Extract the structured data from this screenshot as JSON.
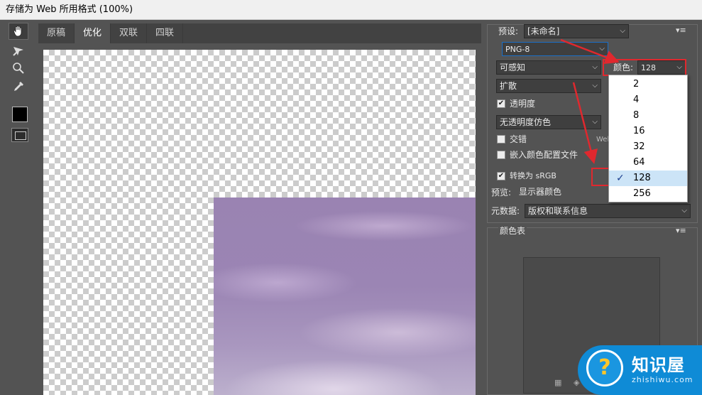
{
  "window": {
    "title": "存储为 Web 所用格式 (100%)"
  },
  "tabs": [
    {
      "label": "原稿",
      "active": false
    },
    {
      "label": "优化",
      "active": true
    },
    {
      "label": "双联",
      "active": false
    },
    {
      "label": "四联",
      "active": false
    }
  ],
  "tools": [
    "hand-icon",
    "slice-select-icon",
    "zoom-icon",
    "eyedropper-icon"
  ],
  "settings": {
    "preset_label": "预设:",
    "preset_value": "[未命名]",
    "format_value": "PNG-8",
    "reduction_value": "可感知",
    "colors_label": "颜色:",
    "colors_value": "128",
    "dither_value": "扩散",
    "transparency_label": "透明度",
    "transparency_dither_value": "无透明度仿色",
    "interlaced_label": "交错",
    "web_snap_label": "Web",
    "embed_profile_label": "嵌入颜色配置文件",
    "convert_srgb_label": "转换为 sRGB",
    "preview_label": "预览:",
    "preview_value": "显示器颜色",
    "metadata_label": "元数据:",
    "metadata_value": "版权和联系信息",
    "color_table_label": "颜色表"
  },
  "colors_dropdown": {
    "options": [
      "2",
      "4",
      "8",
      "16",
      "32",
      "64",
      "128",
      "256"
    ],
    "selected": "128"
  },
  "watermark": {
    "name": "知识屋",
    "url": "zhishiwu.com",
    "symbol": "?"
  },
  "accent_colors": {
    "highlight": "#e0282e",
    "selection": "#cce4f7",
    "panel": "#535353"
  }
}
